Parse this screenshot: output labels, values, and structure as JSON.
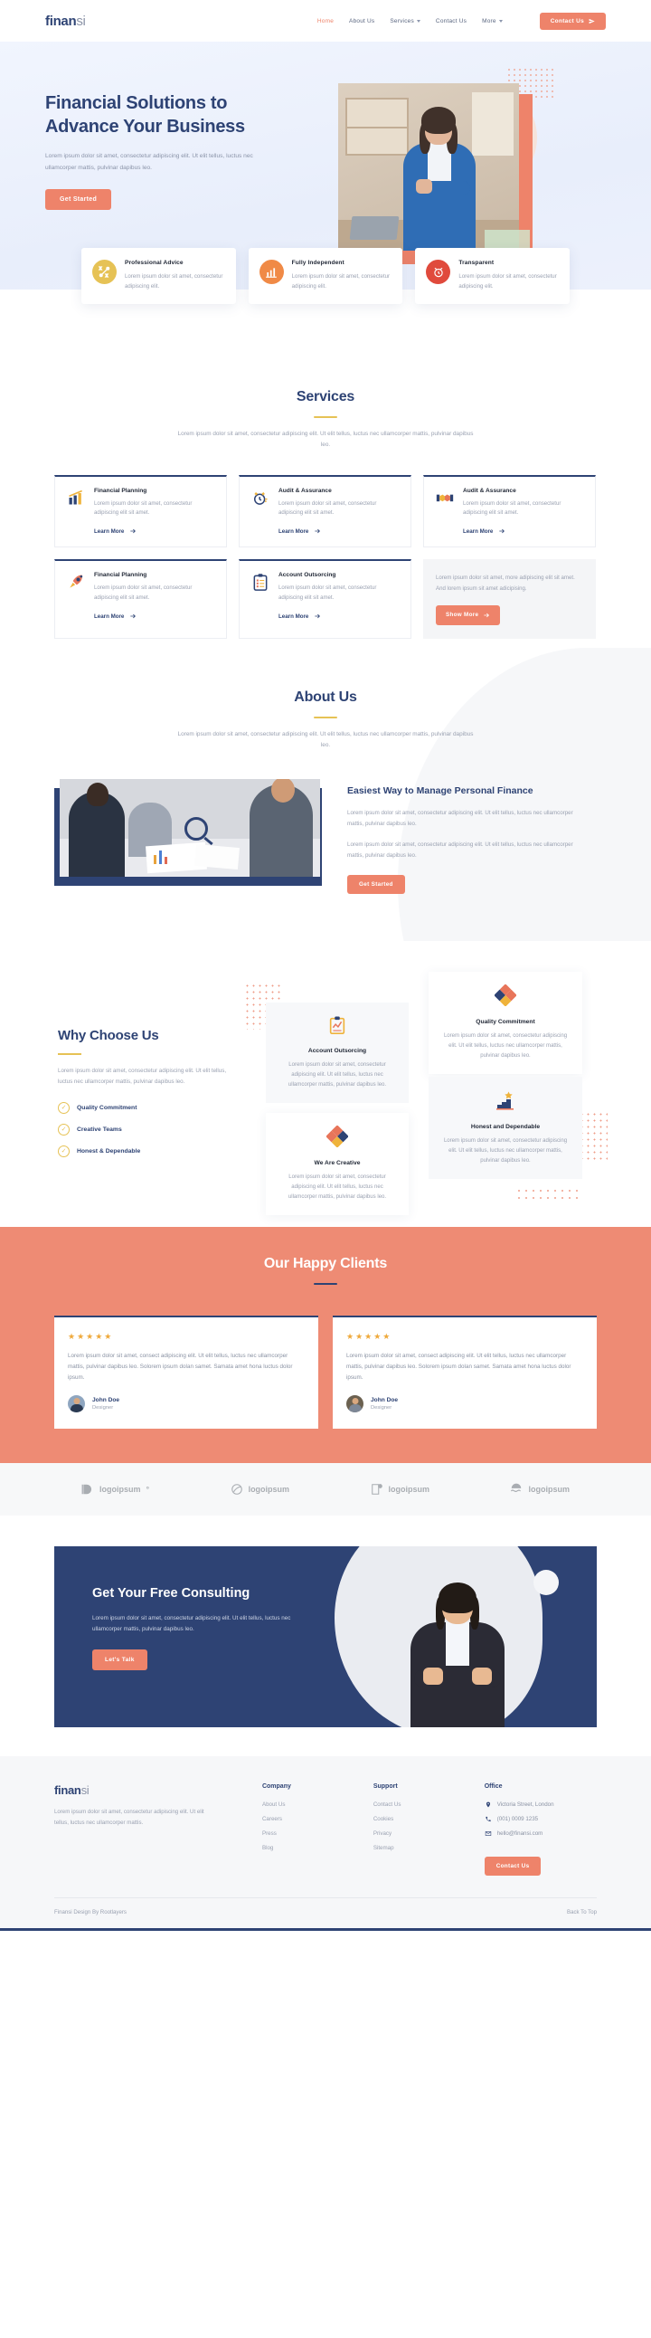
{
  "brand": {
    "bold": "finan",
    "light": "si"
  },
  "header": {
    "nav": [
      {
        "label": "Home",
        "active": true,
        "caret": false
      },
      {
        "label": "About Us",
        "active": false,
        "caret": false
      },
      {
        "label": "Services",
        "active": false,
        "caret": true
      },
      {
        "label": "Contact Us",
        "active": false,
        "caret": false
      },
      {
        "label": "More",
        "active": false,
        "caret": true
      }
    ],
    "cta_label": "Contact Us",
    "cta_icon": "send-icon"
  },
  "hero": {
    "title": "Financial Solutions to Advance Your Business",
    "subtitle": "Lorem ipsum dolor sit amet, consectetur adipiscing elit. Ut elit tellus, luctus nec ullamcorper mattis, pulvinar dapibus leo.",
    "cta_label": "Get Started"
  },
  "features": [
    {
      "icon": "network-advice-icon",
      "color": "#e6c255",
      "title": "Professional Advice",
      "text": "Lorem ipsum dolor sit amet, consectetur adipiscing elit."
    },
    {
      "icon": "bar-chart-icon",
      "color": "#f08a46",
      "title": "Fully Independent",
      "text": "Lorem ipsum dolor sit amet, consectetur adipiscing elit."
    },
    {
      "icon": "alarm-clock-icon",
      "color": "#e04a3c",
      "title": "Transparent",
      "text": "Lorem ipsum dolor sit amet, consectetur adipiscing elit."
    }
  ],
  "services": {
    "title": "Services",
    "subtitle": "Lorem ipsum dolor sit amet, consectetur adipiscing elit. Ut elit tellus, luctus nec ullamcorper mattis, pulvinar dapibus leo.",
    "cards": [
      {
        "icon": "bar-chart-growth-icon",
        "glyph": "📊",
        "title": "Financial Planning",
        "text": "Lorem ipsum dolor sit amet, consectetur adipiscing elit sit amet.",
        "link": "Learn More"
      },
      {
        "icon": "alarm-clock-icon",
        "glyph": "⏰",
        "title": "Audit & Assurance",
        "text": "Lorem ipsum dolor sit amet, consectetur adipiscing elit sit amet.",
        "link": "Learn More"
      },
      {
        "icon": "handshake-icon",
        "glyph": "🤝",
        "title": "Audit & Assurance",
        "text": "Lorem ipsum dolor sit amet, consectetur adipiscing elit sit amet.",
        "link": "Learn More"
      },
      {
        "icon": "rocket-icon",
        "glyph": "🚀",
        "title": "Financial Planning",
        "text": "Lorem ipsum dolor sit amet, consectetur adipiscing elit sit amet.",
        "link": "Learn More"
      },
      {
        "icon": "clipboard-list-icon",
        "glyph": "📋",
        "title": "Account Outsorcing",
        "text": "Lorem ipsum dolor sit amet, consectetur adipiscing elit sit amet.",
        "link": "Learn More"
      }
    ],
    "promo": {
      "text": "Lorem ipsum dolor sit amet, more adipiscing elit sit amet. And lorem ipsum sit amet adicipising.",
      "button": "Show More"
    }
  },
  "about": {
    "title": "About Us",
    "subtitle": "Lorem ipsum dolor sit amet, consectetur adipiscing elit. Ut elit tellus, luctus nec ullamcorper mattis, pulvinar dapibus leo.",
    "heading": "Easiest Way to Manage Personal Finance",
    "para1": "Lorem ipsum dolor sit amet, consectetur adipiscing elit. Ut elit tellus, luctus nec ullamcorper mattis, pulvinar dapibus leo.",
    "para2": "Lorem ipsum dolor sit amet, consectetur adipiscing elit. Ut elit tellus, luctus nec ullamcorper mattis, pulvinar dapibus leo.",
    "cta_label": "Get Started",
    "image_alt": "business-meeting-photo"
  },
  "why": {
    "title": "Why Choose Us",
    "text": "Lorem ipsum dolor sit amet, consectetur adipiscing elit. Ut elit tellus, luctus nec ullamcorper mattis, pulvinar dapibus leo.",
    "list": [
      {
        "label": "Quality Commitment"
      },
      {
        "label": "Creative Teams"
      },
      {
        "label": "Honest & Dependable"
      }
    ],
    "cards": [
      {
        "icon": "clipboard-chart-icon",
        "glyph": "📋",
        "title": "Account Outsorcing",
        "text": "Lorem ipsum dolor sit amet, consectetur adipiscing elit. Ut elit tellus, luctus nec ullamcorper mattis, pulvinar dapibus leo."
      },
      {
        "icon": "puzzle-diamond-icon",
        "glyph": "🧩",
        "title": "We Are Creative",
        "text": "Lorem ipsum dolor sit amet, consectetur adipiscing elit. Ut elit tellus, luctus nec ullamcorper mattis, pulvinar dapibus leo."
      },
      {
        "icon": "puzzle-diamond-icon",
        "glyph": "🧩",
        "title": "Quality Commitment",
        "text": "Lorem ipsum dolor sit amet, consectetur adipiscing elit. Ut elit tellus, luctus nec ullamcorper mattis, pulvinar dapibus leo."
      },
      {
        "icon": "stairs-star-icon",
        "glyph": "🏆",
        "title": "Honest and Dependable",
        "text": "Lorem ipsum dolor sit amet, consectetur adipiscing elit. Ut elit tellus, luctus nec ullamcorper mattis, pulvinar dapibus leo."
      }
    ]
  },
  "testimonials": {
    "title": "Our Happy Clients",
    "items": [
      {
        "stars": "★★★★★",
        "rating": 5,
        "text": "Lorem ipsum dolor sit amet, consect adipiscing elit. Ut elit tellus, luctus nec ullamcorper mattis, pulvinar dapibus leo. Solorem ipsum dolan samet. Samata amet hona luctus dolor ipsum.",
        "name": "John Doe",
        "role": "Designer"
      },
      {
        "stars": "★★★★★",
        "rating": 5,
        "text": "Lorem ipsum dolor sit amet, consect adipiscing elit. Ut elit tellus, luctus nec ullamcorper mattis, pulvinar dapibus leo. Solorem ipsum dolan samet. Samata amet hona luctus dolor ipsum.",
        "name": "John Doe",
        "role": "Designer"
      }
    ]
  },
  "logos": [
    {
      "name": "logoipsum",
      "mark": "half-circle-icon",
      "suffix": "°"
    },
    {
      "name": "logoipsum",
      "mark": "swirl-circle-icon",
      "suffix": ""
    },
    {
      "name": "logoipsum",
      "mark": "square-dot-icon",
      "suffix": ""
    },
    {
      "name": "logoipsum",
      "mark": "waves-icon",
      "suffix": ""
    }
  ],
  "cta": {
    "heading": "Get Your Free Consulting",
    "text": "Lorem ipsum dolor sit amet, consectetur adipiscing elit. Ut elit tellus, luctus nec ullamcorper mattis, pulvinar dapibus leo.",
    "button": "Let's Talk"
  },
  "footer": {
    "desc": "Lorem ipsum dolor sit amet, consectetur adipiscing elit. Ut elit tellus, luctus nec ullamcorper mattis.",
    "company": {
      "heading": "Company",
      "links": [
        "About Us",
        "Careers",
        "Press",
        "Blog"
      ]
    },
    "support": {
      "heading": "Support",
      "links": [
        "Contact Us",
        "Cookies",
        "Privacy",
        "Sitemap"
      ]
    },
    "office": {
      "heading": "Office",
      "address": "Victoria Street, London",
      "phone": "(001) 0009 1235",
      "email": "hello@finansi.com",
      "button": "Contact Us"
    },
    "copyright": "Finansi Design By Rootlayers",
    "back_to_top": "Back To Top"
  },
  "colors": {
    "accent": "#ee836a",
    "navy": "#2e4374",
    "gold": "#e6c255",
    "muted": "#9aa1b1"
  }
}
